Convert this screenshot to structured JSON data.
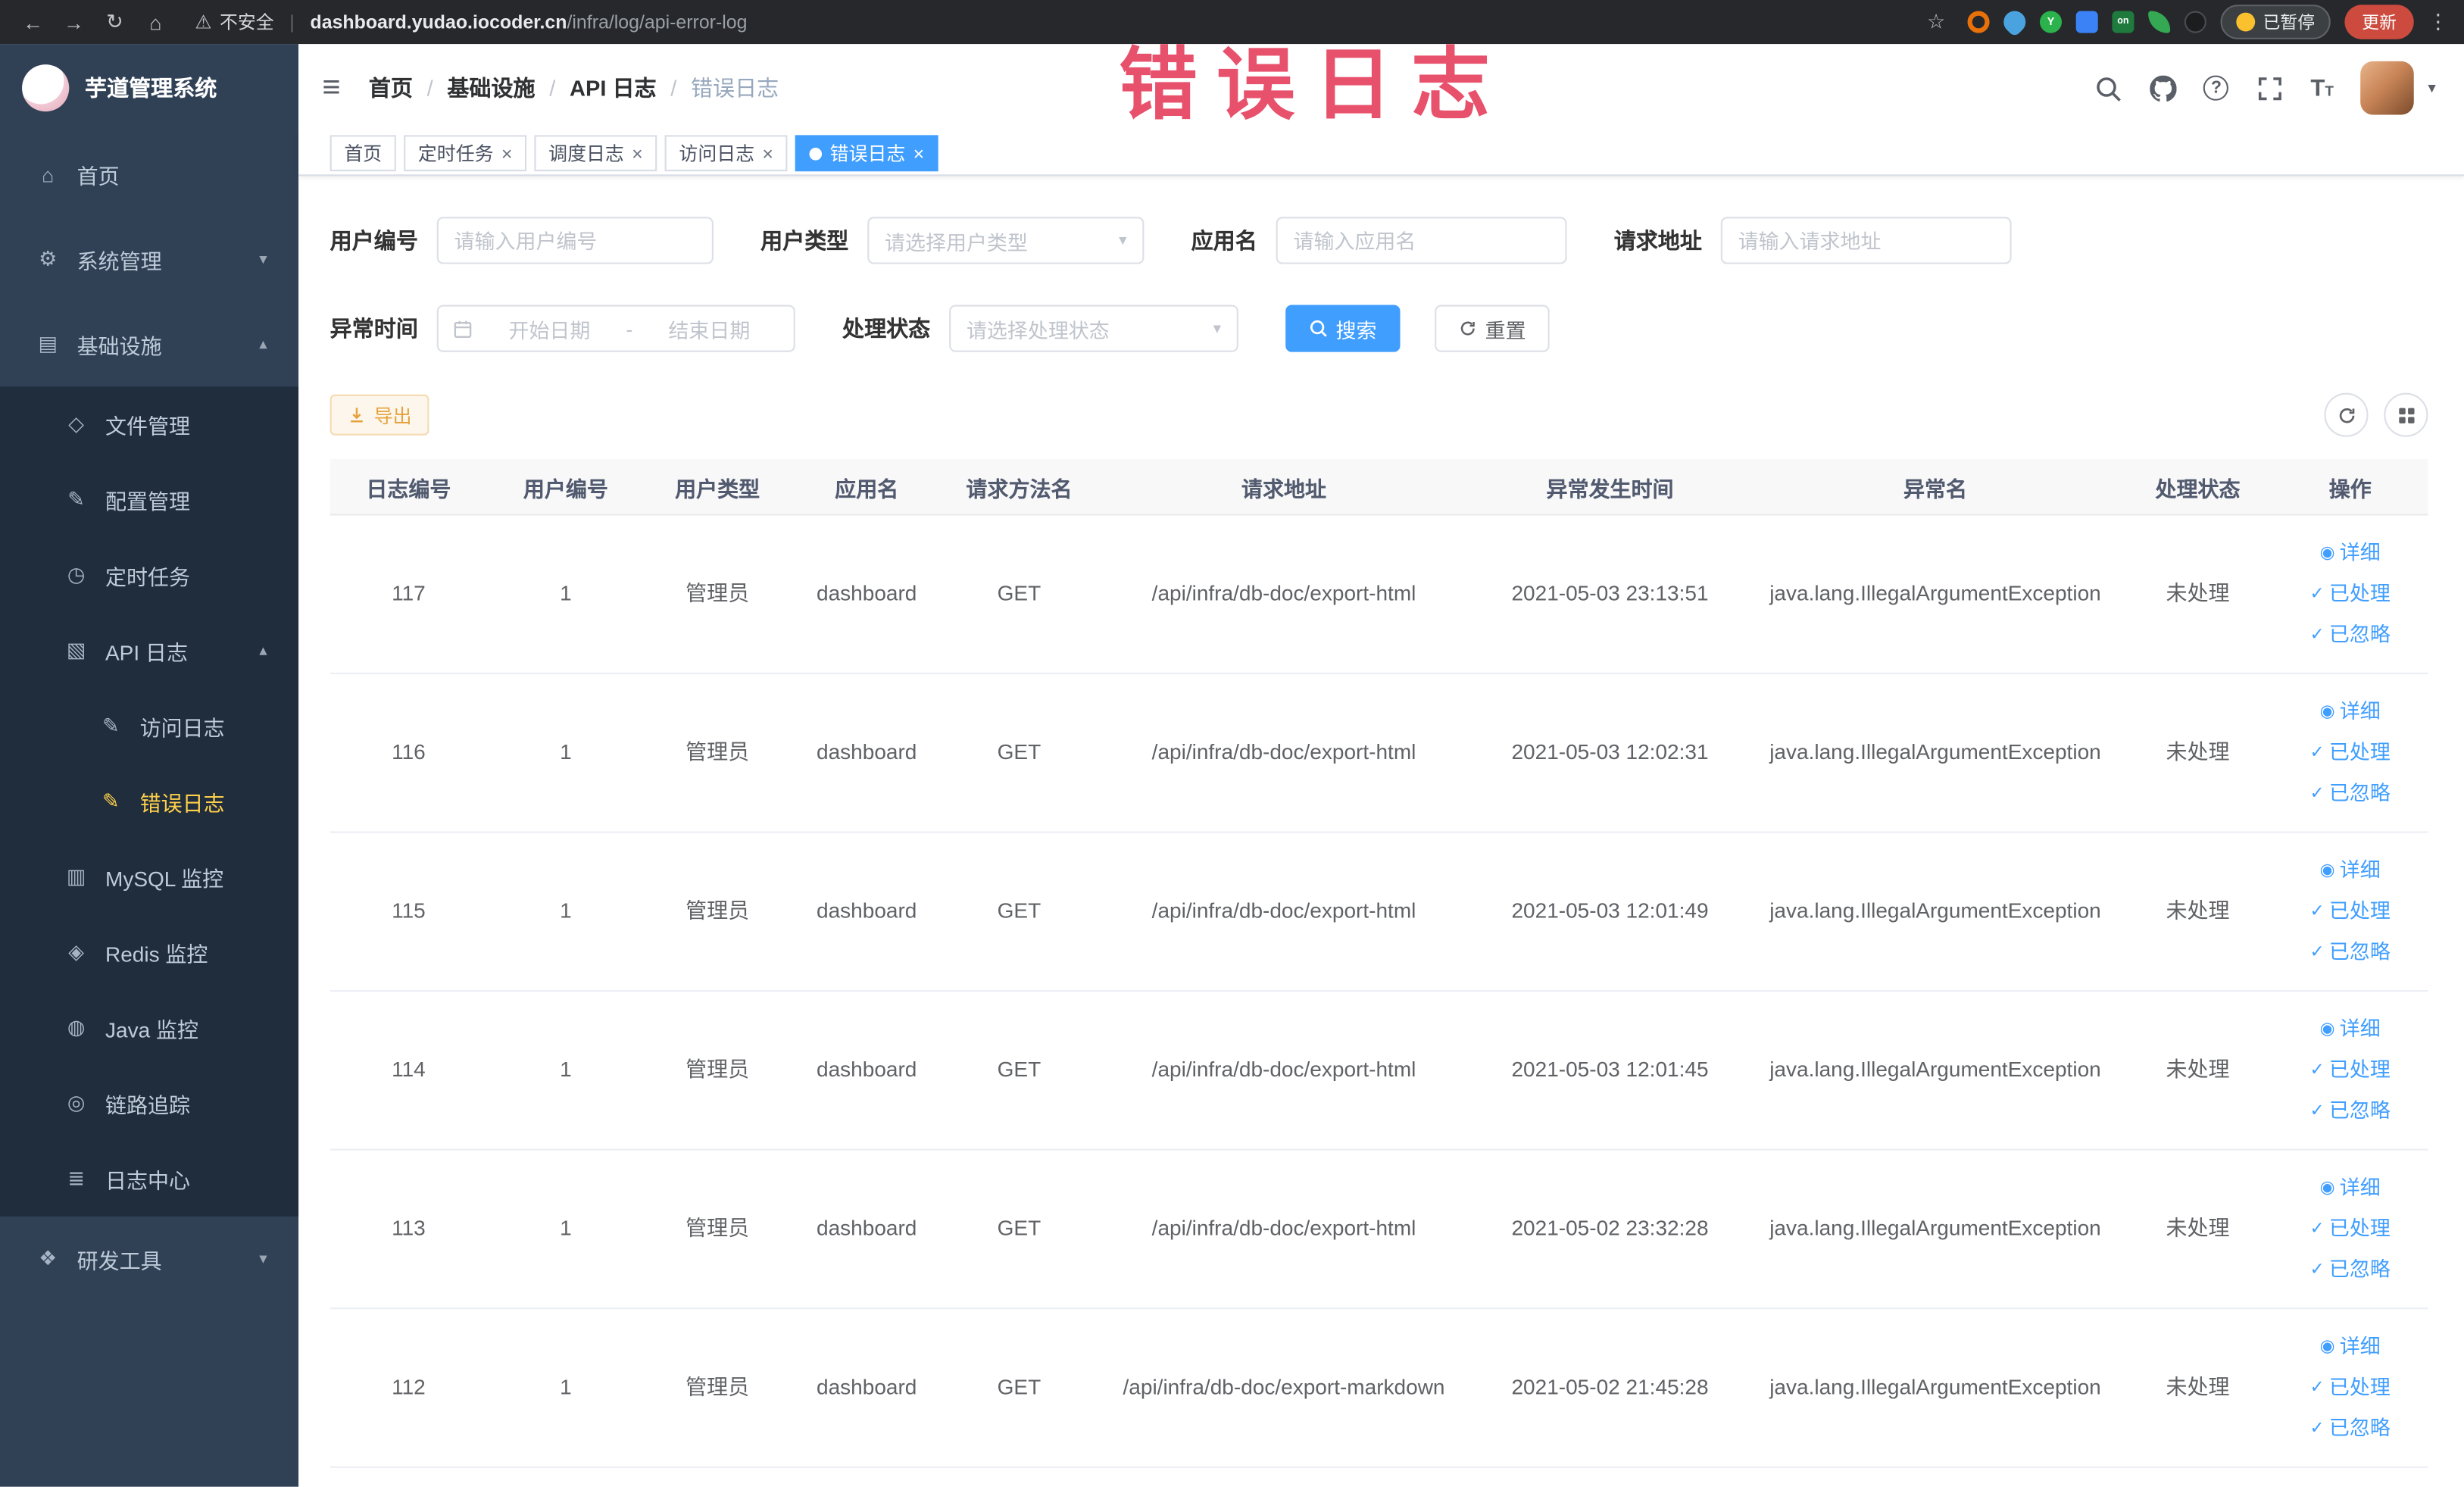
{
  "browser": {
    "security_text": "不安全",
    "url_domain": "dashboard.yudao.iocoder.cn",
    "url_path": "/infra/log/api-error-log",
    "ext_y_label": "Y",
    "ext_on_label": "on",
    "paused_badge": "已暂停",
    "update_button": "更新"
  },
  "annotation": {
    "text": "错误日志"
  },
  "glyphs": {
    "back": "←",
    "forward": "→",
    "reload": "↻",
    "home": "⌂",
    "warning": "⚠",
    "star": "☆",
    "menu_dots": "⋮",
    "hamburger": "≡",
    "chevron_down": "▾",
    "chevron_up": "▴",
    "caret_down": "▾",
    "close": "×",
    "active_dot": "",
    "separator": "/",
    "eye": "◉",
    "check": "✓",
    "sidebar": {
      "home": "⌂",
      "system": "⚙",
      "infra": "▤",
      "file": "◇",
      "config": "✎",
      "job": "◷",
      "apilog": "▧",
      "accesslog": "✎",
      "errorlog": "✎",
      "mysql": "▥",
      "redis": "◈",
      "java": "◍",
      "trace": "◎",
      "logcenter": "≣",
      "tools": "❖"
    }
  },
  "sidebar": {
    "logo_title": "芋道管理系统",
    "items": [
      {
        "label": "首页"
      },
      {
        "label": "系统管理"
      },
      {
        "label": "基础设施"
      },
      {
        "label": "文件管理"
      },
      {
        "label": "配置管理"
      },
      {
        "label": "定时任务"
      },
      {
        "label": "API 日志"
      },
      {
        "label": "访问日志"
      },
      {
        "label": "错误日志"
      },
      {
        "label": "MySQL 监控"
      },
      {
        "label": "Redis 监控"
      },
      {
        "label": "Java 监控"
      },
      {
        "label": "链路追踪"
      },
      {
        "label": "日志中心"
      },
      {
        "label": "研发工具"
      }
    ]
  },
  "breadcrumb": [
    "首页",
    "基础设施",
    "API 日志",
    "错误日志"
  ],
  "tabs": [
    {
      "label": "首页"
    },
    {
      "label": "定时任务"
    },
    {
      "label": "调度日志"
    },
    {
      "label": "访问日志"
    },
    {
      "label": "错误日志"
    }
  ],
  "filters": {
    "user_id": {
      "label": "用户编号",
      "placeholder": "请输入用户编号"
    },
    "user_type": {
      "label": "用户类型",
      "placeholder": "请选择用户类型"
    },
    "app_name": {
      "label": "应用名",
      "placeholder": "请输入应用名"
    },
    "request_url": {
      "label": "请求地址",
      "placeholder": "请输入请求地址"
    },
    "exception_time": {
      "label": "异常时间",
      "start_placeholder": "开始日期",
      "separator": "-",
      "end_placeholder": "结束日期"
    },
    "process_status": {
      "label": "处理状态",
      "placeholder": "请选择处理状态"
    },
    "search_button": "搜索",
    "reset_button": "重置"
  },
  "toolbar": {
    "export_button": "导出"
  },
  "table": {
    "columns": [
      "日志编号",
      "用户编号",
      "用户类型",
      "应用名",
      "请求方法名",
      "请求地址",
      "异常发生时间",
      "异常名",
      "处理状态",
      "操作"
    ],
    "actions": [
      "详细",
      "已处理",
      "已忽略"
    ],
    "rows": [
      {
        "id": "117",
        "user_id": "1",
        "user_type": "管理员",
        "app": "dashboard",
        "method": "GET",
        "url": "/api/infra/db-doc/export-html",
        "time": "2021-05-03 23:13:51",
        "exception": "java.lang.IllegalArgumentException",
        "status": "未处理"
      },
      {
        "id": "116",
        "user_id": "1",
        "user_type": "管理员",
        "app": "dashboard",
        "method": "GET",
        "url": "/api/infra/db-doc/export-html",
        "time": "2021-05-03 12:02:31",
        "exception": "java.lang.IllegalArgumentException",
        "status": "未处理"
      },
      {
        "id": "115",
        "user_id": "1",
        "user_type": "管理员",
        "app": "dashboard",
        "method": "GET",
        "url": "/api/infra/db-doc/export-html",
        "time": "2021-05-03 12:01:49",
        "exception": "java.lang.IllegalArgumentException",
        "status": "未处理"
      },
      {
        "id": "114",
        "user_id": "1",
        "user_type": "管理员",
        "app": "dashboard",
        "method": "GET",
        "url": "/api/infra/db-doc/export-html",
        "time": "2021-05-03 12:01:45",
        "exception": "java.lang.IllegalArgumentException",
        "status": "未处理"
      },
      {
        "id": "113",
        "user_id": "1",
        "user_type": "管理员",
        "app": "dashboard",
        "method": "GET",
        "url": "/api/infra/db-doc/export-html",
        "time": "2021-05-02 23:32:28",
        "exception": "java.lang.IllegalArgumentException",
        "status": "未处理"
      },
      {
        "id": "112",
        "user_id": "1",
        "user_type": "管理员",
        "app": "dashboard",
        "method": "GET",
        "url": "/api/infra/db-doc/export-markdown",
        "time": "2021-05-02 21:45:28",
        "exception": "java.lang.IllegalArgumentException",
        "status": "未处理"
      }
    ]
  }
}
